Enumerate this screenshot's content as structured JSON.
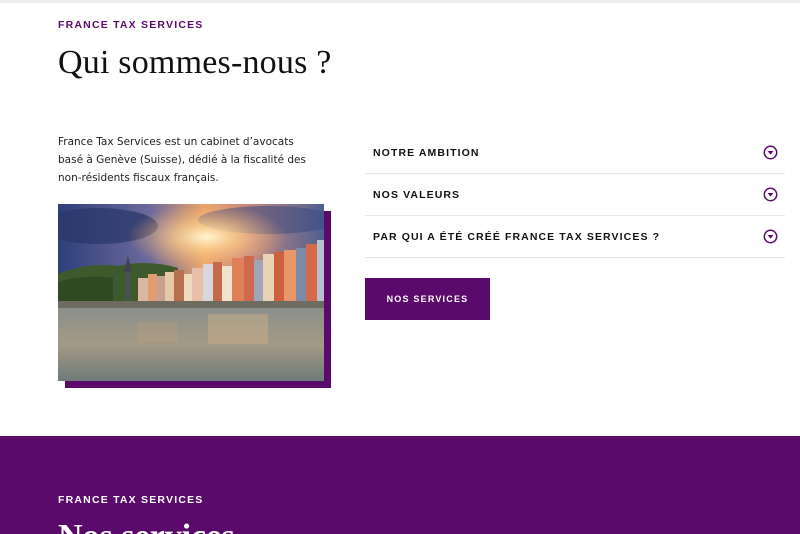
{
  "section_intro": {
    "eyebrow": "FRANCE TAX SERVICES",
    "title": "Qui sommes-nous ?",
    "description": "France Tax Services est un cabinet d’avocats basé à Genève (Suisse), dédié à la fiscalité des non-résidents fiscaux français."
  },
  "photo": {
    "subject": "city riverside at sunset"
  },
  "accordion": {
    "items": [
      {
        "label": "NOTRE AMBITION",
        "icon": "chevron-down-circle-icon"
      },
      {
        "label": "NOS VALEURS",
        "icon": "chevron-down-circle-icon"
      },
      {
        "label": "PAR QUI A ÉTÉ CRÉÉ FRANCE TAX SERVICES ?",
        "icon": "chevron-down-circle-icon"
      }
    ]
  },
  "cta": {
    "label": "NOS SERVICES"
  },
  "services_section": {
    "eyebrow": "FRANCE TAX SERVICES",
    "title": "Nos services"
  },
  "colors": {
    "brand_purple": "#5a0a6a",
    "text_dark": "#111111",
    "divider": "#e6e6e6"
  }
}
